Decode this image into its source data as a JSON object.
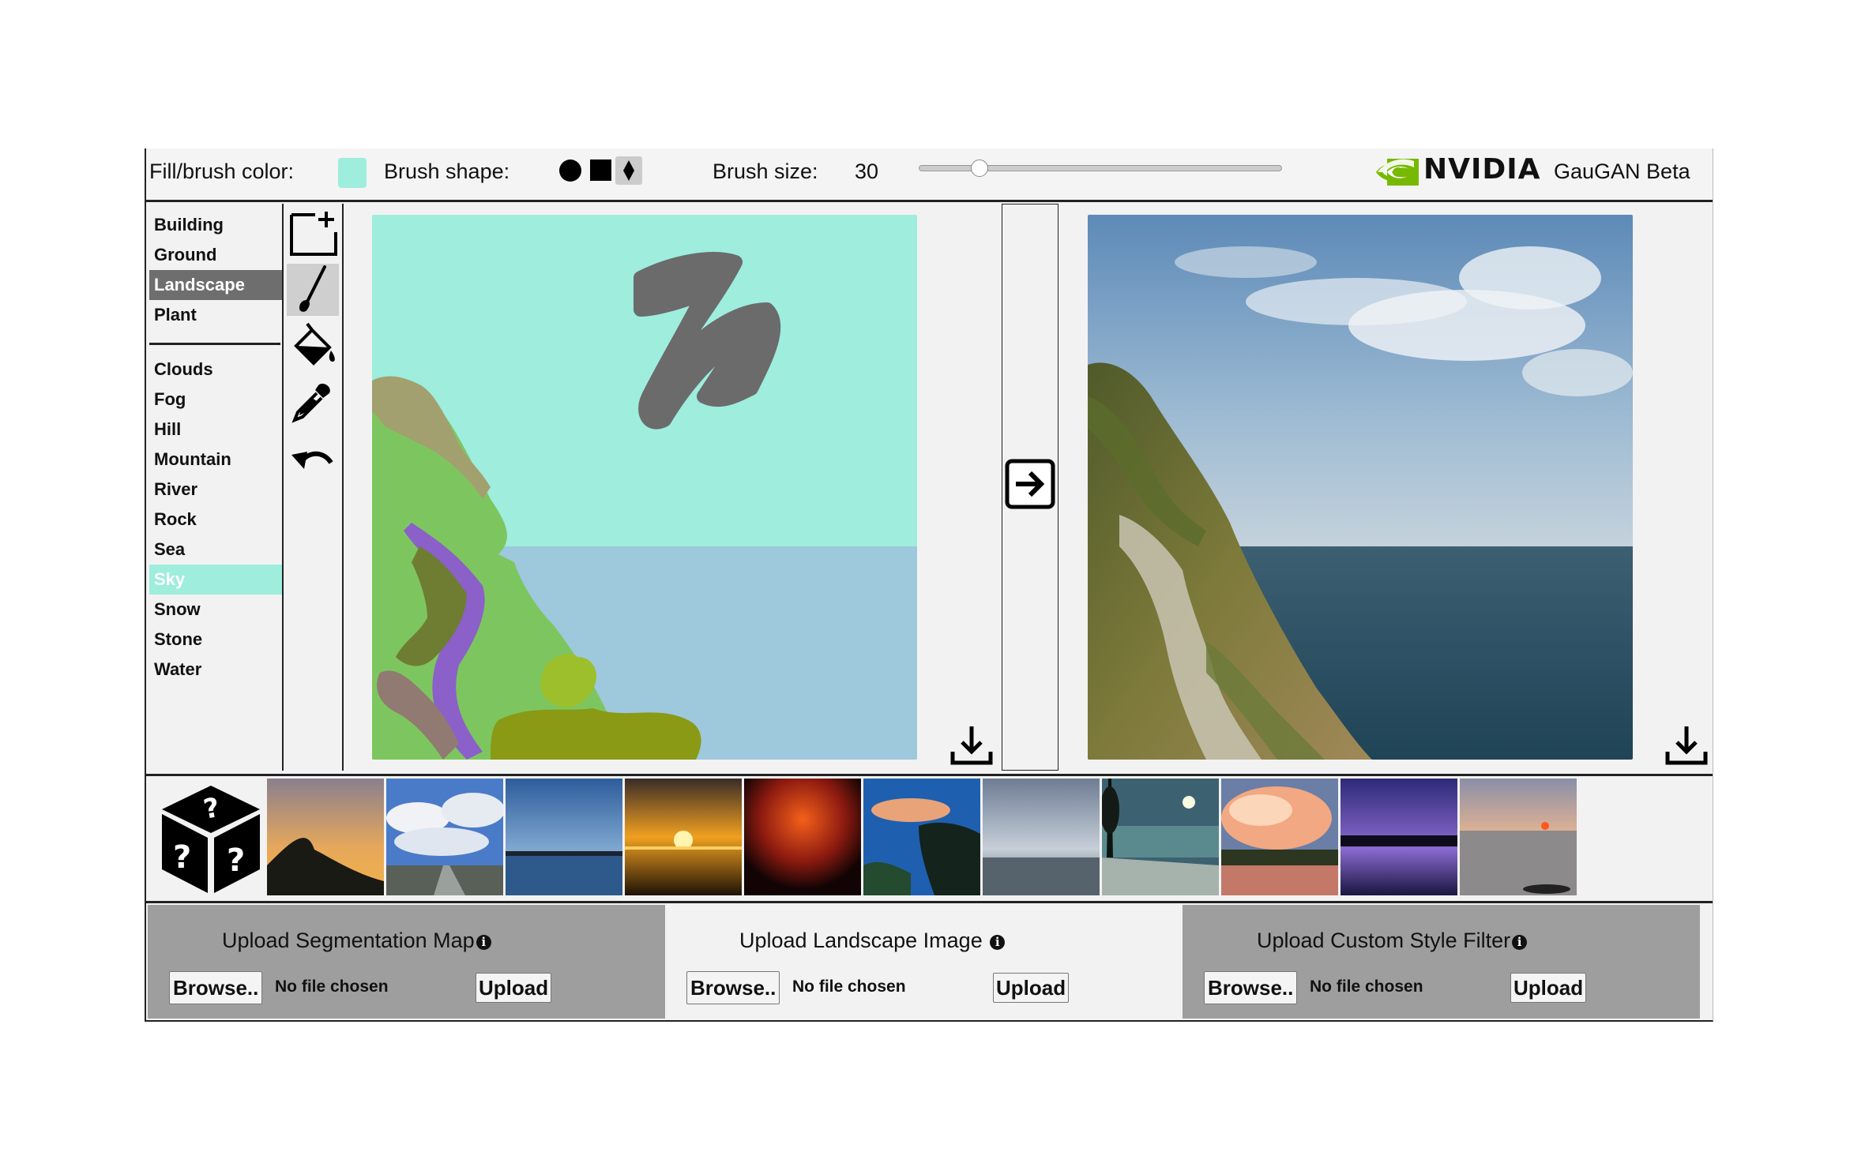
{
  "toolbar": {
    "fill_label": "Fill/brush color:",
    "brush_color": "#9eeddd",
    "shape_label": "Brush shape:",
    "shapes": [
      "circle",
      "square",
      "diamond"
    ],
    "selected_shape": "diamond",
    "size_label": "Brush size:",
    "brush_size": "30",
    "slider_fraction": 0.15,
    "brand": "NVIDIA",
    "app_title": "GauGAN Beta"
  },
  "labels": {
    "group1": [
      {
        "name": "Building",
        "selected": false
      },
      {
        "name": "Ground",
        "selected": false
      },
      {
        "name": "Landscape",
        "selected": true
      },
      {
        "name": "Plant",
        "selected": false
      }
    ],
    "group2": [
      {
        "name": "Clouds"
      },
      {
        "name": "Fog"
      },
      {
        "name": "Hill"
      },
      {
        "name": "Mountain"
      },
      {
        "name": "River"
      },
      {
        "name": "Rock"
      },
      {
        "name": "Sea"
      },
      {
        "name": "Sky",
        "highlight": "#9eeddd"
      },
      {
        "name": "Snow"
      },
      {
        "name": "Stone"
      },
      {
        "name": "Water"
      }
    ]
  },
  "tools": [
    "new-canvas-icon",
    "brush-icon",
    "paint-bucket-icon",
    "eyedropper-icon",
    "undo-icon"
  ],
  "active_tool": "brush-icon",
  "colors": {
    "sky": "#9eeddd",
    "sea": "#9ec8dc",
    "landscape": "#7dc65f",
    "clouds_stroke": "#6b6b6b",
    "river": "#8b60c9",
    "rock": "#917a71",
    "mountain": "#a3a070",
    "plant": "#6f7d33",
    "tree": "#9cbf2b",
    "selected_label_bg": "#6e6e6e"
  },
  "upload": {
    "segmentation": {
      "title": "Upload Segmentation Map",
      "browse": "Browse..",
      "nofile": "No file chosen",
      "upload": "Upload"
    },
    "landscape": {
      "title": "Upload Landscape Image ",
      "browse": "Browse..",
      "nofile": "No file chosen",
      "upload": "Upload"
    },
    "style": {
      "title": "Upload Custom Style Filter",
      "browse": "Browse..",
      "nofile": "No file chosen",
      "upload": "Upload"
    }
  },
  "info_glyph": "i",
  "style_thumbnails": [
    "sunset-tree",
    "clouds-road",
    "blue-dusk-lake",
    "orange-sunset-sea",
    "red-sunset",
    "blue-cliff-coast",
    "grey-cloudy-beach",
    "night-moon-lake",
    "pink-cloud-sunset",
    "purple-lake-dusk",
    "pastel-sunset-sea"
  ]
}
